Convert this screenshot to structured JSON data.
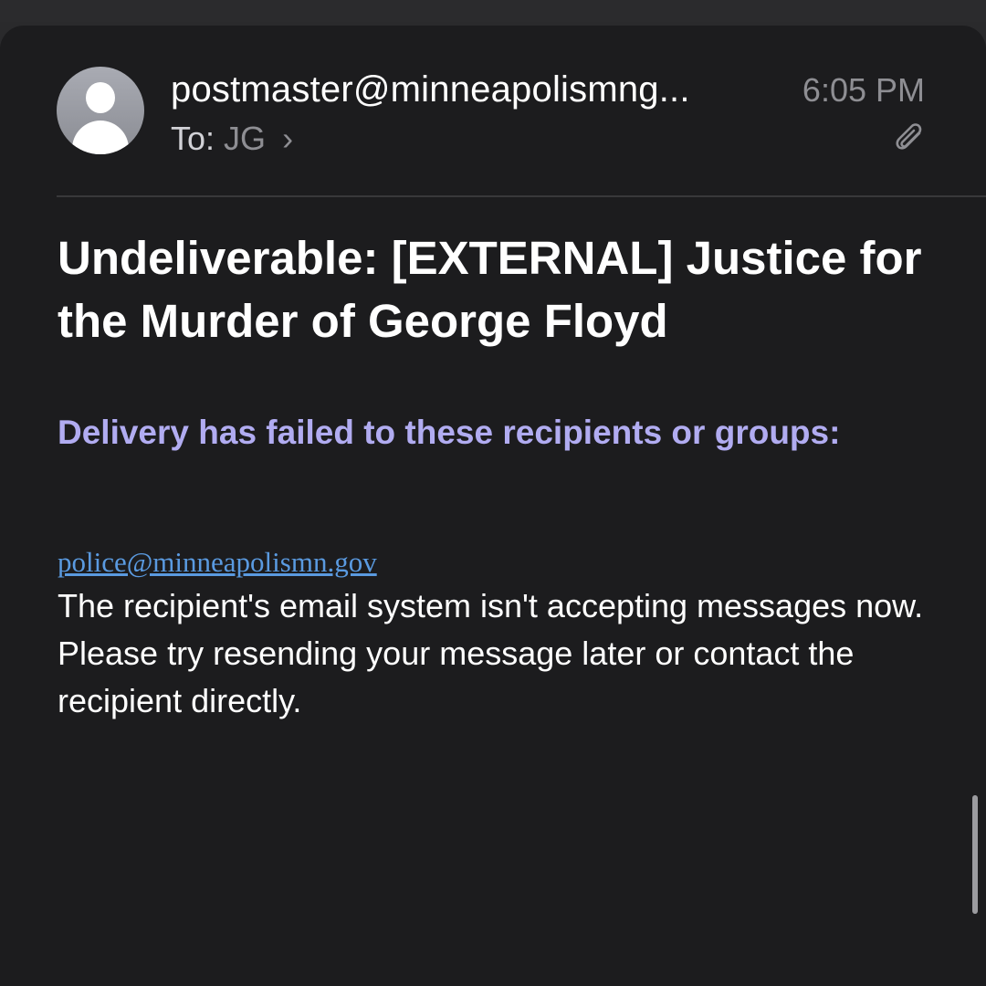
{
  "email": {
    "sender": "postmaster@minneapolismng...",
    "time": "6:05 PM",
    "to_label": "To:",
    "to_recipient": "JG",
    "chevron": "›",
    "subject": "Undeliverable: [EXTERNAL] Justice for the Murder of George Floyd",
    "body": {
      "failed_heading": "Delivery has failed to these recipients or groups:",
      "failed_recipient": "police@minneapolismn.gov",
      "message": "The recipient's email system isn't accepting messages now. Please try resending your message later or contact the recipient directly."
    }
  },
  "icons": {
    "avatar": "person-avatar-icon",
    "attachment": "paperclip-icon"
  },
  "colors": {
    "background": "#1c1c1e",
    "heading_accent": "#b1acf1",
    "link": "#5a9ae0",
    "muted": "#8e8e93"
  }
}
